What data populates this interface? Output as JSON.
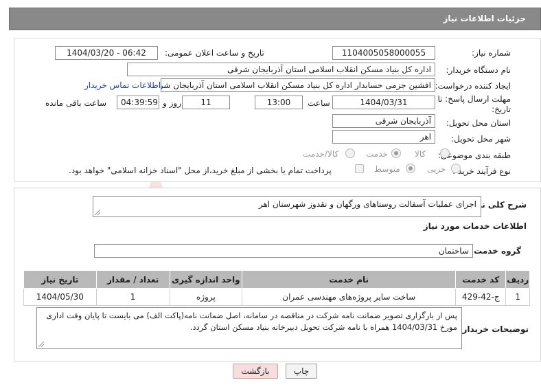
{
  "header": {
    "title": "جزئیات اطلاعات نیاز"
  },
  "need": {
    "number_label": "شماره نیاز:",
    "number_value": "1104005058000055",
    "announce_label": "تاریخ و ساعت اعلان عمومی:",
    "announce_value": "1404/03/20 - 06:42",
    "buyer_label": "نام دستگاه خریدار:",
    "buyer_value": "اداره کل بنیاد مسکن انقلاب اسلامی استان آذربایجان شرقی",
    "requester_label": "ایجاد کننده درخواست:",
    "requester_value": "افشین جزمی حسابدار اداره کل بنیاد مسکن انقلاب اسلامی استان آذربایجان شرقی",
    "contact_link": "اطلاعات تماس خریدار",
    "deadline_label_1": "مهلت ارسال پاسخ: تا",
    "deadline_label_2": "تاریخ:",
    "deadline_date": "1404/03/31",
    "time_label": "ساعت",
    "deadline_time": "13:00",
    "days_value": "11",
    "days_label": "روز و",
    "remaining_value": "04:39:59",
    "remaining_label": "ساعت باقی مانده",
    "province_label": "استان محل تحویل:",
    "province_value": "آذربایجان شرقی",
    "city_label": "شهر محل تحویل:",
    "city_value": "اهر",
    "category_label": "طبقه بندی موضوعی:",
    "category_options": [
      "کالا",
      "خدمت",
      "کالا/خدمت"
    ],
    "category_selected": "خدمت",
    "process_label": "نوع فرآیند خرید :",
    "process_options": [
      "جزیی",
      "متوسط"
    ],
    "process_selected": "متوسط",
    "payment_note": "پرداخت تمام یا بخشی از مبلغ خرید،از محل \"اسناد خزانه اسلامی\" خواهد بود."
  },
  "general": {
    "desc_label": "شرح کلی نیاز:",
    "desc_value": "اجرای عملیات آسفالت روستاهای ورگهان و نقدوز شهرستان اهر",
    "services_heading": "اطلاعات خدمات مورد نیاز",
    "group_label": "گروه خدمت:",
    "group_value": "ساختمان"
  },
  "table": {
    "headers": [
      "ردیف",
      "کد خدمت",
      "نام خدمت",
      "واحد اندازه گیری",
      "تعداد / مقدار",
      "تاریخ نیاز"
    ],
    "rows": [
      [
        "1",
        "ج-42-429",
        "ساخت سایر پروژه‌های مهندسی عمران",
        "پروژه",
        "1",
        "1404/05/30"
      ]
    ]
  },
  "buyer_notes": {
    "label": "توضیحات خریدار:",
    "line1": "پس از بارگزاری تصویر ضمانت نامه شرکت در مناقصه در سامانه، اصل ضمانت نامه(پاکت الف) می بایست تا پایان وقت اداری",
    "line2": "مورخ 1404/03/31 همراه با نامه شرکت تحویل دبیرخانه بنیاد مسکن استان گردد."
  },
  "buttons": {
    "print": "چاپ",
    "back": "بازگشت"
  },
  "watermark": "AriaTender.neT",
  "colors": {
    "header_bg": "#898989",
    "table_header_bg": "#b9b9b9",
    "back_button_bg": "#f6dede",
    "link": "#1a3fbf",
    "watermark": "#c0272d"
  }
}
